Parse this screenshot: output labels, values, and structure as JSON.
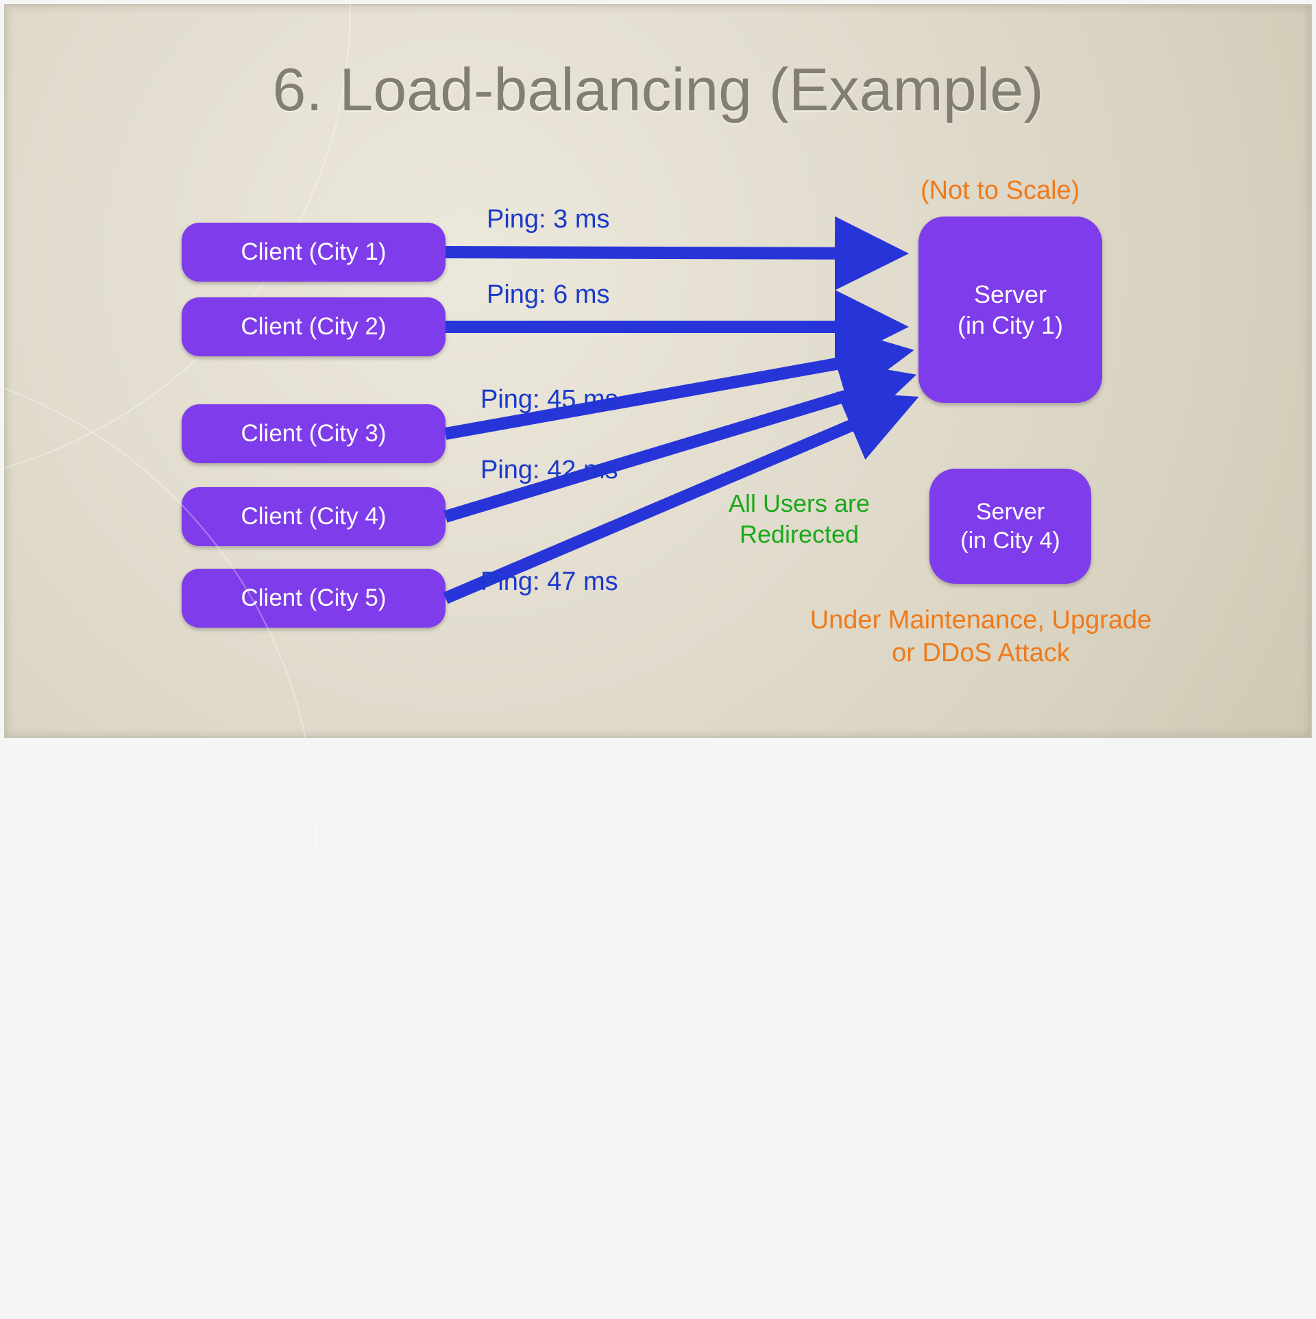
{
  "title": "6. Load-balancing (Example)",
  "clients": [
    {
      "label": "Client (City 1)",
      "ping": "Ping: 3 ms"
    },
    {
      "label": "Client (City 2)",
      "ping": "Ping: 6 ms"
    },
    {
      "label": "Client (City 3)",
      "ping": "Ping: 45 ms"
    },
    {
      "label": "Client (City 4)",
      "ping": "Ping: 42 ms"
    },
    {
      "label": "Client (City 5)",
      "ping": "Ping: 47 ms"
    }
  ],
  "servers": {
    "primary": {
      "line1": "Server",
      "line2": "(in City 1)"
    },
    "secondary": {
      "line1": "Server",
      "line2": "(in City 4)"
    }
  },
  "notes": {
    "scale": "(Not to Scale)",
    "redirect": {
      "line1": "All Users are",
      "line2": "Redirected"
    },
    "maintenance": {
      "line1": "Under Maintenance, Upgrade",
      "line2": "or DDoS Attack"
    }
  },
  "colors": {
    "box": "#7e3cea",
    "arrow": "#2735d8",
    "title": "#837e72",
    "orange": "#ef7a1a",
    "green": "#1aa81a",
    "pingText": "#1a39cc"
  }
}
